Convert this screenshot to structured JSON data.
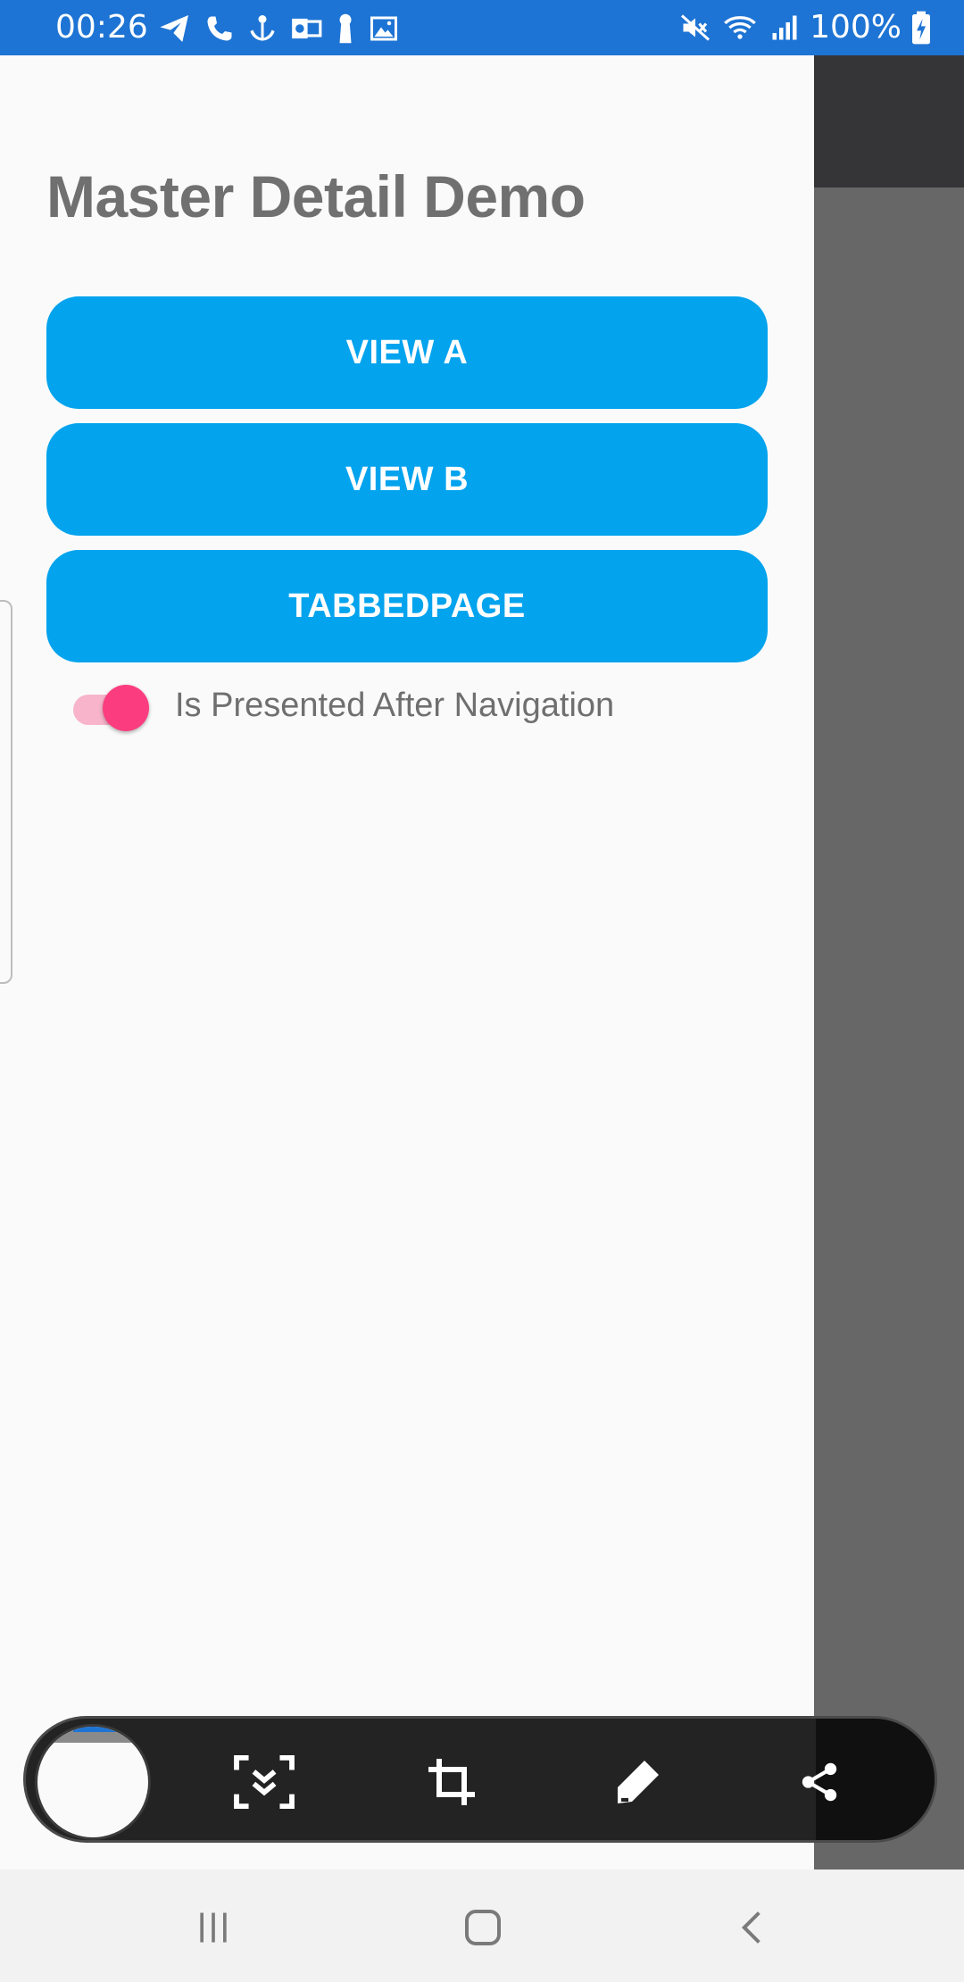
{
  "status_bar": {
    "time": "00:26",
    "battery_percent": "100%",
    "left_icons": [
      "telegram-icon",
      "phone-icon",
      "anchor-icon",
      "outlook-icon",
      "keyhole-icon",
      "image-icon"
    ],
    "right_icons": [
      "mute-icon",
      "wifi-icon",
      "signal-icon",
      "battery-charging-icon"
    ]
  },
  "drawer": {
    "title": "Master Detail Demo",
    "buttons": [
      {
        "label": "VIEW A"
      },
      {
        "label": "VIEW B"
      },
      {
        "label": "TABBEDPAGE"
      }
    ],
    "toggle": {
      "label": "Is Presented After Navigation",
      "on": true
    }
  },
  "screenshot_toolbar": {
    "tools": [
      "scroll-capture-icon",
      "crop-icon",
      "draw-icon",
      "share-icon"
    ]
  },
  "nav_bar": {
    "buttons": [
      "recents-icon",
      "home-icon",
      "back-icon"
    ]
  },
  "colors": {
    "status_bar": "#1e74d4",
    "button": "#03a3ee",
    "toggle_thumb": "#fb3d7f",
    "toggle_track": "#f7b4cb",
    "scrim": "#676767"
  }
}
